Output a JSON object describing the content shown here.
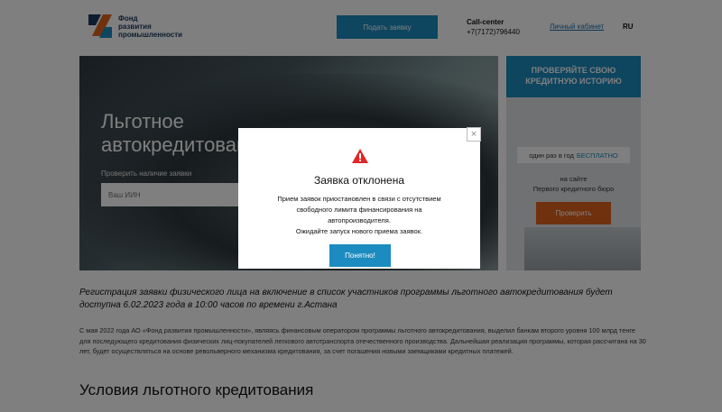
{
  "header": {
    "logo_lines": [
      "Фонд",
      "развития",
      "промышленности"
    ],
    "apply_button": "Подать заявку",
    "callcenter_title": "Call-center",
    "callcenter_phone": "+7(7172)796440",
    "cabinet_link": "Личный кабинет",
    "language": "RU"
  },
  "hero": {
    "title_lines": [
      "Льготное",
      "автокредитование"
    ],
    "check_label": "Проверить наличие заявки",
    "iin_placeholder": "Ваш ИИН"
  },
  "side_banner": {
    "title_lines": [
      "ПРОВЕРЯЙТЕ СВОЮ",
      "КРЕДИТНУЮ ИСТОРИЮ"
    ],
    "once_text": "один раз в год",
    "free_text": "БЕСПЛАТНО",
    "site_lines": [
      "на сайте",
      "Первого кредитного бюро"
    ],
    "check_button": "Проверить"
  },
  "content": {
    "registration_text": "Регистрация заявки физического лица на включение в список участников программы льготного автокредитования будет доступна 6.02.2023 года в 10:00 часов по времени г.Астана",
    "body_text": "С мая 2022 года АО «Фонд развития промышленности», являясь финансовым оператором программы льготного автокредитования, выделил банкам второго уровня 100 млрд тенге для последующего кредитования физических лиц-покупателей легкового автотранспорта отечественного производства. Дальнейшая реализация программы, которая рассчитана на 30 лет, будет осуществляться на основе револьверного механизма кредитования, за счет погашения новыми заемщиками кредитных платежей.",
    "conditions_heading": "Условия льготного кредитования"
  },
  "modal": {
    "close_symbol": "×",
    "title": "Заявка отклонена",
    "message_lines": [
      "Прием заявок приостановлен в связи с отсутствием",
      "свободного лимита финансирования на",
      "автопроизводителя.",
      "Ожидайте запуск нового приема заявок."
    ],
    "ok_button": "Понятно!"
  },
  "colors": {
    "accent": "#1c8bbf",
    "orange": "#e0631f",
    "warning": "#e32626"
  }
}
